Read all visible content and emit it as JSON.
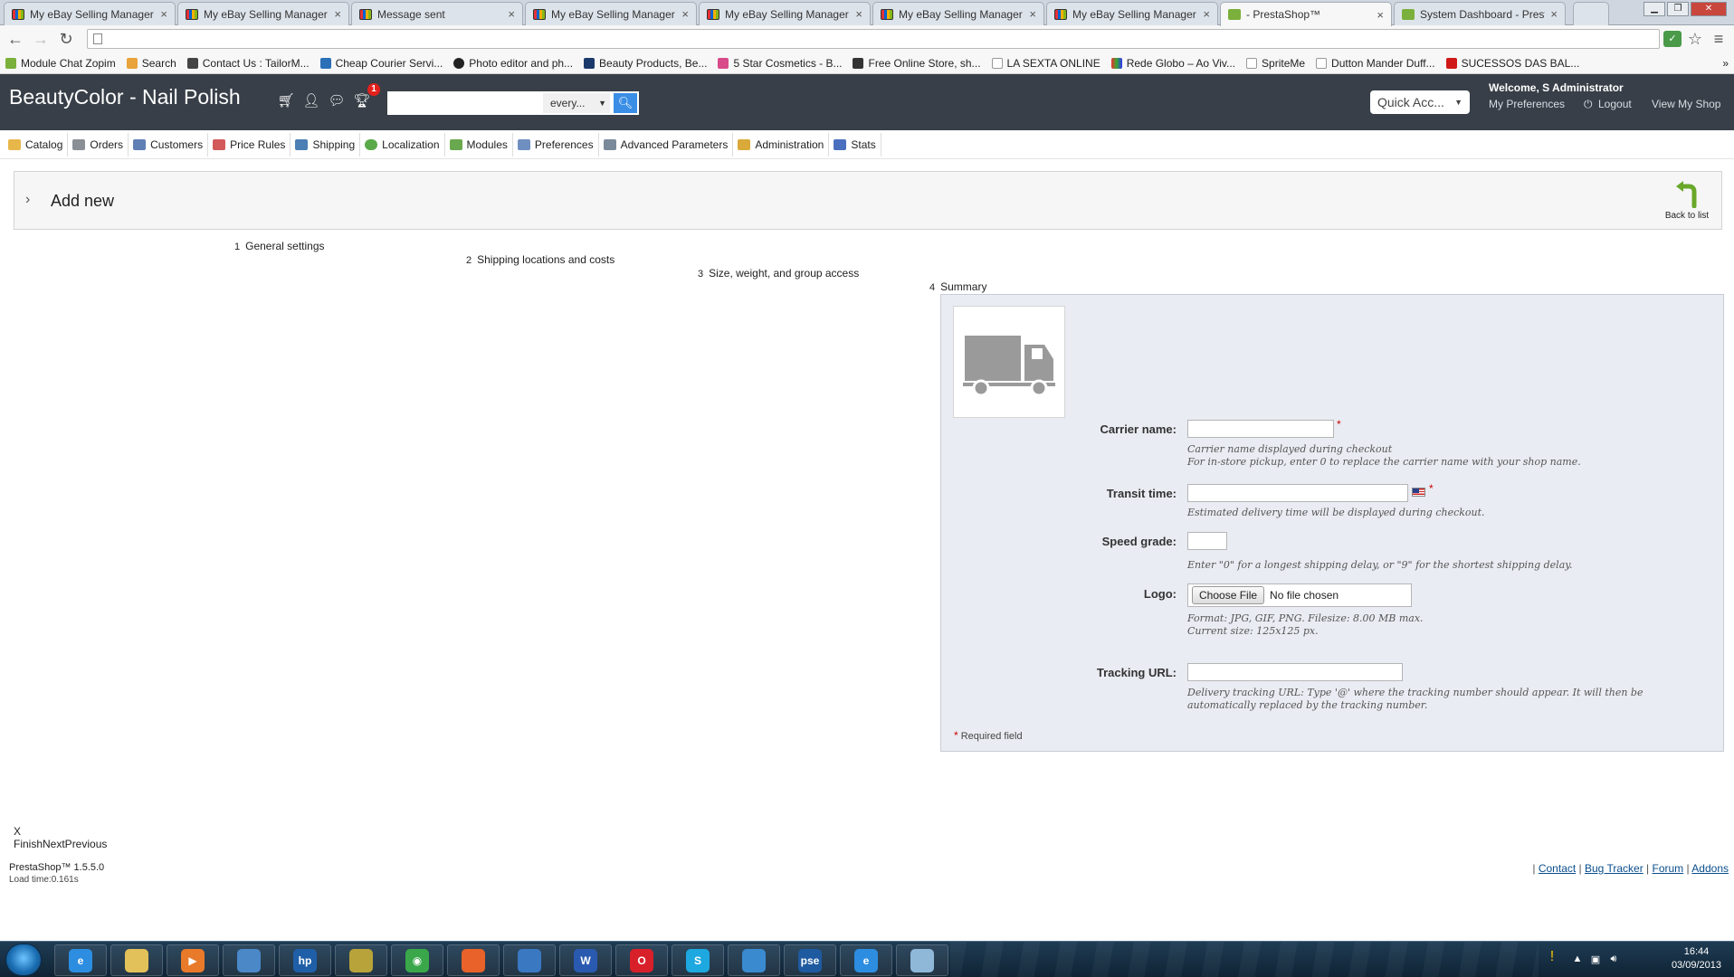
{
  "browser": {
    "tabs": [
      {
        "title": "My eBay Selling Manager",
        "favicon": "ebay-icon"
      },
      {
        "title": "My eBay Selling Manager",
        "favicon": "ebay-icon"
      },
      {
        "title": "Message sent",
        "favicon": "ebay-icon"
      },
      {
        "title": "My eBay Selling Manager",
        "favicon": "ebay-icon"
      },
      {
        "title": "My eBay Selling Manager",
        "favicon": "ebay-icon"
      },
      {
        "title": "My eBay Selling Manager",
        "favicon": "ebay-icon"
      },
      {
        "title": "My eBay Selling Manager",
        "favicon": "ebay-icon"
      },
      {
        "title": "- PrestaShop™",
        "favicon": "prestashop-icon",
        "active": true
      },
      {
        "title": "System Dashboard - Presta",
        "favicon": "prestashop-icon"
      }
    ],
    "tab_close": "×",
    "address": "",
    "bookmarks": [
      "Module Chat Zopim",
      "Search",
      "Contact Us : TailorM...",
      "Cheap Courier Servi...",
      "Photo editor and ph...",
      "Beauty Products, Be...",
      "5 Star Cosmetics - B...",
      "Free Online Store, sh...",
      "LA SEXTA ONLINE",
      "Rede Globo – Ao Viv...",
      "SpriteMe",
      "Dutton Mander Duff...",
      "SUCESSOS DAS BAL..."
    ],
    "bookmarks_more": "»"
  },
  "header": {
    "shop_name": "BeautyColor - Nail Polish",
    "notification_count": "1",
    "search_placeholder": "",
    "search_scope": "every...",
    "quick_access": "Quick Acc...",
    "welcome": "Welcome, S Administrator",
    "my_preferences": "My Preferences",
    "logout": "Logout",
    "view_my_shop": "View My Shop"
  },
  "menu": [
    {
      "label": "Catalog",
      "color": "#e8b74a"
    },
    {
      "label": "Orders",
      "color": "#8a8f96"
    },
    {
      "label": "Customers",
      "color": "#5f7fb5"
    },
    {
      "label": "Price Rules",
      "color": "#d25a5a"
    },
    {
      "label": "Shipping",
      "color": "#4c7fb3"
    },
    {
      "label": "Localization",
      "color": "#5aaa4a"
    },
    {
      "label": "Modules",
      "color": "#6aa84f"
    },
    {
      "label": "Preferences",
      "color": "#6f8fc0"
    },
    {
      "label": "Advanced Parameters",
      "color": "#7a8a9a"
    },
    {
      "label": "Administration",
      "color": "#d9a93a"
    },
    {
      "label": "Stats",
      "color": "#4a6fbf"
    }
  ],
  "toolbar": {
    "title": "Add new",
    "back_label": "Back to list"
  },
  "wizard": {
    "steps": [
      {
        "num": "1",
        "label": "General settings"
      },
      {
        "num": "2",
        "label": "Shipping locations and costs"
      },
      {
        "num": "3",
        "label": "Size, weight, and group access"
      },
      {
        "num": "4",
        "label": "Summary"
      }
    ],
    "close": "X",
    "actions": "FinishNextPrevious"
  },
  "form": {
    "carrier_name_label": "Carrier name:",
    "carrier_name_value": "",
    "carrier_name_help_1": "Carrier name displayed during checkout",
    "carrier_name_help_2": "For in-store pickup, enter 0 to replace the carrier name with your shop name.",
    "transit_time_label": "Transit time:",
    "transit_time_value": "",
    "transit_time_help": "Estimated delivery time will be displayed during checkout.",
    "speed_grade_label": "Speed grade:",
    "speed_grade_value": "",
    "speed_grade_help": "Enter \"0\" for a longest shipping delay, or \"9\" for the shortest shipping delay.",
    "logo_label": "Logo:",
    "choose_file": "Choose File",
    "no_file": "No file chosen",
    "logo_help_1": "Format: JPG, GIF, PNG. Filesize: 8.00 MB max.",
    "logo_help_2": "Current size: 125x125 px.",
    "tracking_url_label": "Tracking URL:",
    "tracking_url_value": "",
    "tracking_help_1": "Delivery tracking URL: Type '@' where the tracking number should appear. It will then be",
    "tracking_help_2": "automatically replaced by the tracking number.",
    "required_star": "*",
    "required_note": "Required field"
  },
  "footer": {
    "version": "PrestaShop™ 1.5.5.0",
    "load_time": "Load time:0.161s",
    "links": [
      "Contact",
      "Bug Tracker",
      "Forum",
      "Addons"
    ]
  },
  "taskbar": {
    "apps": [
      {
        "name": "internet-explorer",
        "color": "#2d8de0",
        "glyph": "e"
      },
      {
        "name": "file-explorer",
        "color": "#e3c15a",
        "glyph": ""
      },
      {
        "name": "media-player",
        "color": "#e87a2a",
        "glyph": "▶"
      },
      {
        "name": "network-tool",
        "color": "#4a88c8",
        "glyph": ""
      },
      {
        "name": "hp-tool",
        "color": "#1f5fa8",
        "glyph": "hp"
      },
      {
        "name": "archive-tool",
        "color": "#b8a33a",
        "glyph": ""
      },
      {
        "name": "chrome",
        "color": "#3aa84a",
        "glyph": "◉"
      },
      {
        "name": "firefox",
        "color": "#e8622a",
        "glyph": ""
      },
      {
        "name": "thunderbird",
        "color": "#3a78c2",
        "glyph": ""
      },
      {
        "name": "word",
        "color": "#2a5ab0",
        "glyph": "W"
      },
      {
        "name": "opera",
        "color": "#d8202a",
        "glyph": "O"
      },
      {
        "name": "skype",
        "color": "#1ea8e0",
        "glyph": "S"
      },
      {
        "name": "media-tool",
        "color": "#3a8ad0",
        "glyph": ""
      },
      {
        "name": "pse",
        "color": "#1e5aa0",
        "glyph": "pse"
      },
      {
        "name": "internet-explorer-2",
        "color": "#2d8de0",
        "glyph": "e"
      },
      {
        "name": "notes-tool",
        "color": "#8fb8d8",
        "glyph": ""
      }
    ],
    "time": "16:44",
    "date": "03/09/2013"
  }
}
